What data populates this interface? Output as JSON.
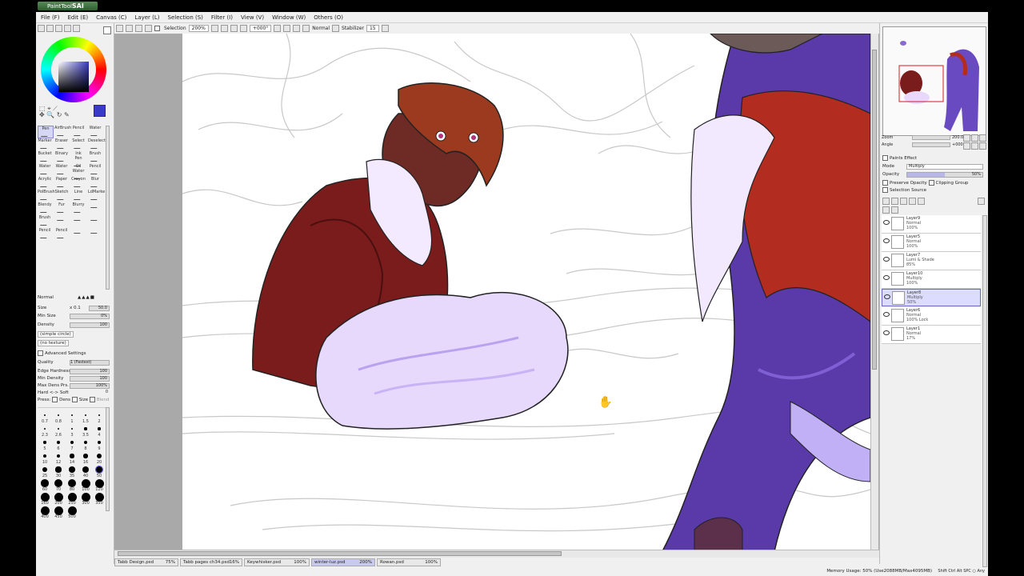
{
  "app": {
    "name": "PaintTool",
    "name_em": "SAI"
  },
  "menu": [
    "File (F)",
    "Edit (E)",
    "Canvas (C)",
    "Layer (L)",
    "Selection (S)",
    "Filter (I)",
    "View (V)",
    "Window (W)",
    "Others (O)"
  ],
  "toolbar": {
    "selection_label": "Selection",
    "zoom": "200%",
    "angle": "+000°",
    "blend": "Normal",
    "stabilizer_label": "Stabilizer",
    "stabilizer_value": "15"
  },
  "tools": [
    "Pen",
    "AirBrush",
    "Pencil",
    "Water",
    "Marker",
    "Eraser",
    "Select",
    "Deselect",
    "Bucket",
    "Binary",
    "Ink Pen",
    "Brush",
    "Water",
    "Water",
    "Oil Water",
    "Pencil",
    "Acrylic",
    "Paper",
    "Crayon",
    "Blur",
    "PolBrush",
    "Sketch",
    "Line",
    "LdMarke",
    "Blendy",
    "Fur",
    "Blurry",
    "",
    "Brush",
    "",
    "",
    "",
    "Pencil",
    "Pencil",
    "",
    ""
  ],
  "brush": {
    "mode": "Normal",
    "size_label": "Size",
    "size_mult": "x 0.1",
    "size_value": "50.0",
    "min_size_label": "Min Size",
    "min_size_value": "0%",
    "density_label": "Density",
    "density_value": "100",
    "shape": "(simple circle)",
    "texture": "(no texture)",
    "advanced_label": "Advanced Settings",
    "quality_label": "Quality",
    "quality_value": "1 (Fastest)",
    "edge_label": "Edge Hardness",
    "edge_value": "100",
    "min_density_label": "Min Density",
    "min_density_value": "100",
    "max_dens_label": "Max Dens Prs.",
    "max_dens_value": "100%",
    "hard_soft_label": "Hard <-> Soft",
    "hard_soft_value": "0",
    "press_label": "Press:",
    "dens_label": "Dens",
    "size2_label": "Size",
    "blend_label": "Blend"
  },
  "brush_sizes": [
    "0.7",
    "0.8",
    "1",
    "1.5",
    "2",
    "2.3",
    "2.6",
    "3",
    "3.5",
    "4",
    "5",
    "6",
    "7",
    "8",
    "9",
    "10",
    "12",
    "14",
    "16",
    "20",
    "25",
    "30",
    "35",
    "40",
    "50",
    "60",
    "70",
    "80",
    "100",
    "120",
    "160",
    "200",
    "250",
    "300",
    "350",
    "400",
    "450",
    "500"
  ],
  "navigator": {
    "zoom_label": "Zoom",
    "zoom_value": "200.0%",
    "angle_label": "Angle",
    "angle_value": "+000$"
  },
  "layers_panel": {
    "paints_effect": "Paints Effect",
    "mode_label": "Mode",
    "mode_value": "Multiply",
    "opacity_label": "Opacity",
    "opacity_value": "50%",
    "preserve_opacity": "Preserve Opacity",
    "clipping_group": "Clipping Group",
    "selection_source": "Selection Source"
  },
  "layers": [
    {
      "name": "Layer9",
      "mode": "Normal",
      "opacity": "100%"
    },
    {
      "name": "Layer5",
      "mode": "Normal",
      "opacity": "100%"
    },
    {
      "name": "Layer7",
      "mode": "Lumi & Shade",
      "opacity": "85%"
    },
    {
      "name": "Layer10",
      "mode": "Multiply",
      "opacity": "100%"
    },
    {
      "name": "Layer8",
      "mode": "Multiply",
      "opacity": "50%"
    },
    {
      "name": "Layer6",
      "mode": "Normal",
      "opacity": "100% Lock"
    },
    {
      "name": "Layer1",
      "mode": "Normal",
      "opacity": "17%"
    }
  ],
  "tabs": [
    {
      "name": "Tabb Design.psd",
      "pct": "75%"
    },
    {
      "name": "Tabb pages ch34.psd",
      "pct": "16%"
    },
    {
      "name": "Keywhisker.psd",
      "pct": "100%"
    },
    {
      "name": "winter-luz.psd",
      "pct": "200%"
    },
    {
      "name": "Rowan.psd",
      "pct": "100%"
    }
  ],
  "status": {
    "memory": "Memory Usage: 50% (Use2088MB/Max4095MB)",
    "keys": "Shift Ctrl Alt SPC ○ Any"
  }
}
